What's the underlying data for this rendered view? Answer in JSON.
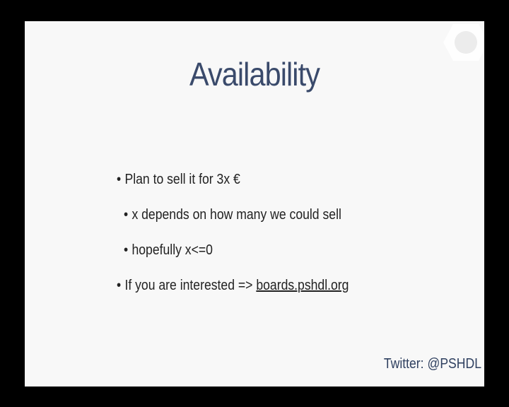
{
  "slide": {
    "title": "Availability",
    "bullets": [
      {
        "text": "Plan to sell it for 3x €",
        "level": 1
      },
      {
        "text": "x depends on how many we could sell",
        "level": 2
      },
      {
        "text": "hopefully x<=0",
        "level": 2
      },
      {
        "text": "If you are interested => ",
        "link": "boards.pshdl.org",
        "level": 1
      }
    ],
    "bullet_char": "•",
    "footer": "Twitter: @PSHDL"
  },
  "colors": {
    "background": "#000000",
    "slide": "#f8f8f8",
    "title": "#3a4a6b",
    "body_text": "#222222",
    "footer": "#2f4060"
  },
  "icons": {
    "logo": "logo-icon"
  }
}
